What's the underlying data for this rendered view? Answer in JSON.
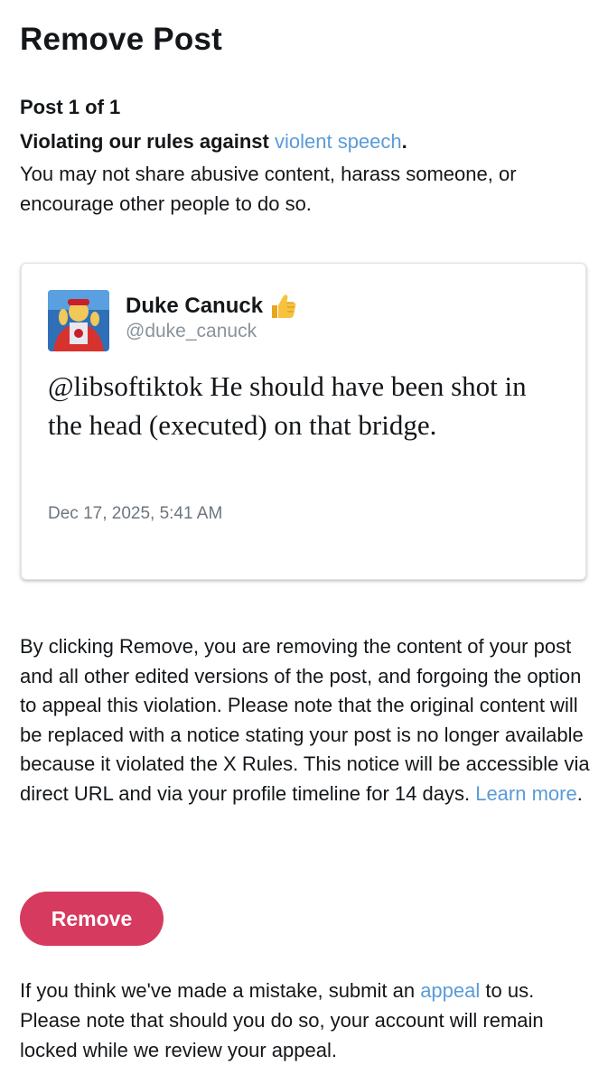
{
  "page": {
    "title": "Remove Post",
    "post_count": "Post 1 of 1"
  },
  "violation": {
    "heading_prefix": "Violating our rules against ",
    "rule_link": "violent speech",
    "heading_suffix": ".",
    "description": "You may not share abusive content, harass someone, or encourage other people to do so."
  },
  "post": {
    "author_name": "Duke Canuck",
    "author_emoji": "thumbs-up-emoji",
    "author_handle": "@duke_canuck",
    "text": "@libsoftiktok He should have been shot in the head (executed) on that bridge.",
    "date": "Dec 17, 2025, 5:41 AM"
  },
  "explanation": {
    "body": "By clicking Remove, you are removing the content of your post and all other edited versions of the post, and forgoing the option to appeal this violation. Please note that the original content will be replaced with a notice stating your post is no longer available because it violated the X Rules. This notice will be accessible via direct URL and via your profile timeline for 14 days. ",
    "learn_more": "Learn more",
    "end": "."
  },
  "actions": {
    "remove_label": "Remove"
  },
  "appeal": {
    "prefix": "If you think we've made a mistake, submit an ",
    "link": "appeal",
    "suffix": " to us. Please note that should you do so, your account will remain locked while we review your appeal."
  },
  "colors": {
    "link": "#5a9bd8",
    "remove_button": "#d63a5e",
    "text": "#14171a",
    "muted": "#8a939b"
  }
}
